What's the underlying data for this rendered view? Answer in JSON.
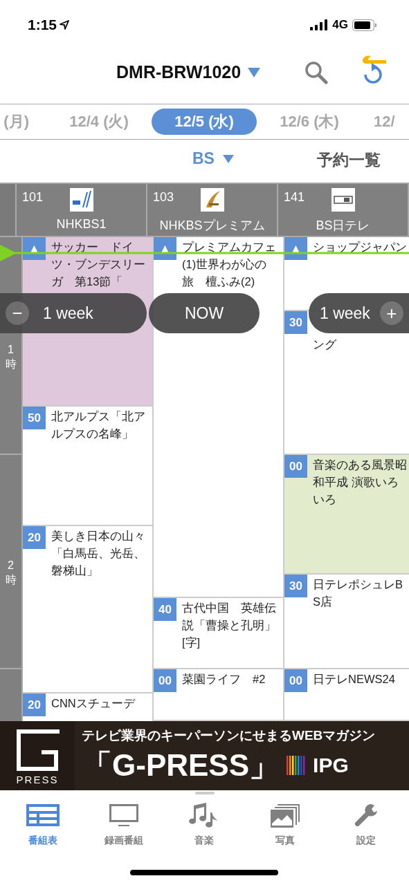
{
  "status_bar": {
    "time": "1:15",
    "network": "4G"
  },
  "header": {
    "device": "DMR-BRW1020"
  },
  "dates": [
    {
      "label": "(月)",
      "selected": false
    },
    {
      "label": "12/4 (火)",
      "selected": false
    },
    {
      "label": "12/5 (水)",
      "selected": true
    },
    {
      "label": "12/6 (木)",
      "selected": false
    },
    {
      "label": "12/",
      "selected": false
    }
  ],
  "band": {
    "label": "BS",
    "reservations": "予約一覧"
  },
  "hours": [
    {
      "label": "1時"
    },
    {
      "label": "2時"
    }
  ],
  "channels": [
    {
      "number": "101",
      "name": "NHKBS1",
      "programs": [
        {
          "kind": "normal",
          "start": "▲",
          "title": "サッカー　ドイツ・ブンデスリーガ　第13節「",
          "color": "#e0c8dc"
        },
        {
          "kind": "normal",
          "start": "50",
          "title": "北アルプス「北アルプスの名峰」",
          "color": "#ffffff"
        },
        {
          "kind": "normal",
          "start": "20",
          "title": "美しき日本の山々「白馬岳、光岳、磐梯山」",
          "color": "#ffffff"
        },
        {
          "kind": "normal",
          "start": "20",
          "title": "CNNスチューデ",
          "color": "#ffffff"
        }
      ]
    },
    {
      "number": "103",
      "name": "NHKBSプレミアム",
      "programs": [
        {
          "kind": "normal",
          "start": "▲",
          "title": "プレミアムカフェ(1)世界わが心の旅　檀ふみ(2)",
          "color": "#ffffff"
        },
        {
          "kind": "normal",
          "start": "40",
          "title": "古代中国　英雄伝説「曹操と孔明」[字]",
          "color": "#ffffff"
        },
        {
          "kind": "normal",
          "start": "00",
          "title": "菜園ライフ　#2",
          "color": "#ffffff"
        }
      ]
    },
    {
      "number": "141",
      "name": "BS日テレ",
      "programs": [
        {
          "kind": "normal",
          "start": "▲",
          "title": "ショップジャパン",
          "color": "#ffffff"
        },
        {
          "kind": "top_covered",
          "start": "30",
          "title": "ング",
          "color": "#ffffff"
        },
        {
          "kind": "normal",
          "start": "00",
          "title": "音楽のある風景昭和平成 演歌いろいろ",
          "color": "#e3ebcd"
        },
        {
          "kind": "normal",
          "start": "30",
          "title": "日テレポシュレBS店",
          "color": "#ffffff"
        },
        {
          "kind": "normal",
          "start": "00",
          "title": "日テレNEWS24",
          "color": "#ffffff"
        }
      ]
    }
  ],
  "zoom_controls": {
    "minus": "−",
    "left": "1 week",
    "now": "NOW",
    "right": "1 week",
    "plus": "+"
  },
  "ad": {
    "tagline": "テレビ業界のキーパーソンにせまるWEBマガジン",
    "title": "「G-PRESS」",
    "logo_text": "PRESS",
    "brand": "IPG"
  },
  "tabs": [
    {
      "label": "番組表",
      "selected": true
    },
    {
      "label": "録画番組",
      "selected": false
    },
    {
      "label": "音楽",
      "selected": false
    },
    {
      "label": "写真",
      "selected": false
    },
    {
      "label": "設定",
      "selected": false
    }
  ]
}
